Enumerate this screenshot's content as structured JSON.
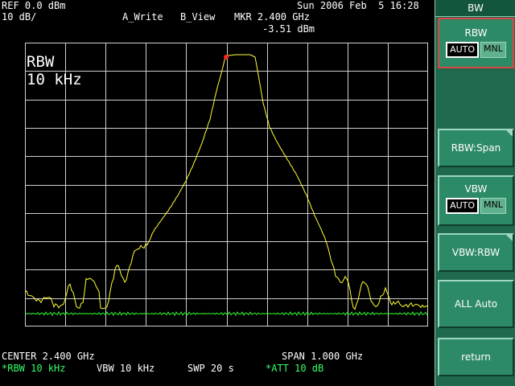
{
  "status": {
    "ref": "REF 0.0 dBm",
    "scale": "10 dB/",
    "trace_a": "A_Write",
    "trace_b": "B_View",
    "marker_freq": "MKR 2.400 GHz",
    "marker_level": "-3.51 dBm",
    "datetime": "Sun 2006 Feb  5 16:28"
  },
  "overlay": {
    "line1": "RBW",
    "line2": "10 kHz"
  },
  "footer": {
    "center": "CENTER 2.400 GHz",
    "span": "SPAN 1.000 GHz",
    "rbw": "*RBW 10 kHz",
    "vbw": "VBW 10 kHz",
    "sweep": "SWP 20 s",
    "att": "*ATT 10 dB"
  },
  "menu": {
    "title": "BW",
    "rbw_label": "RBW",
    "rbw_auto": "AUTO",
    "rbw_mnl": "MNL",
    "rbw_span": "RBW:Span",
    "vbw_label": "VBW",
    "vbw_auto": "AUTO",
    "vbw_mnl": "MNL",
    "vbw_rbw": "VBW:RBW",
    "all_auto": "ALL Auto",
    "return": "return"
  },
  "colors": {
    "trace": "#ffff33",
    "noise": "#33ff33",
    "marker": "#ff2222",
    "grid": "#d0d0d0",
    "panel": "#2d8a66"
  }
}
